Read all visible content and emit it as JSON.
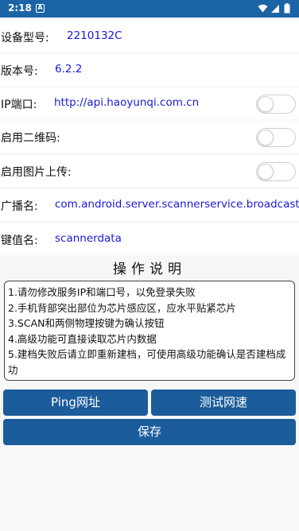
{
  "status_bar": {
    "time": "2:18",
    "notification_icon_letter": "A",
    "wifi_icon": "wifi-icon",
    "signal_icon": "signal-icon",
    "battery_icon": "battery-icon"
  },
  "settings": {
    "device_model": {
      "label": "设备型号:",
      "value": "2210132C"
    },
    "version": {
      "label": "版本号:",
      "value": "6.2.2"
    },
    "ip_port": {
      "label": "IP端口:",
      "value": "http://api.haoyunqi.com.cn",
      "toggle_on": false
    },
    "qr_code": {
      "label": "启用二维码:",
      "toggle_on": false
    },
    "image_upload": {
      "label": "启用图片上传:",
      "toggle_on": false
    },
    "broadcast": {
      "label": "广播名:",
      "value": "com.android.server.scannerservice.broadcast"
    },
    "key_name": {
      "label": "键值名:",
      "value": "scannerdata"
    }
  },
  "instructions": {
    "title": "操作说明",
    "lines": [
      "1.请勿修改服务IP和端口号，以免登录失败",
      "2.手机背部突出部位为芯片感应区，应水平贴紧芯片",
      "3.SCAN和两侧物理按键为确认按钮",
      "4.高级功能可直接读取芯片内数据",
      "5.建档失败后请立即重新建档，可使用高级功能确认是否建档成功"
    ]
  },
  "buttons": {
    "ping": "Ping网址",
    "speed_test": "测试网速",
    "save": "保存"
  },
  "colors": {
    "status_bar": "#1b64a5",
    "button": "#1b5c9b",
    "value_text": "#1a1ad6"
  }
}
